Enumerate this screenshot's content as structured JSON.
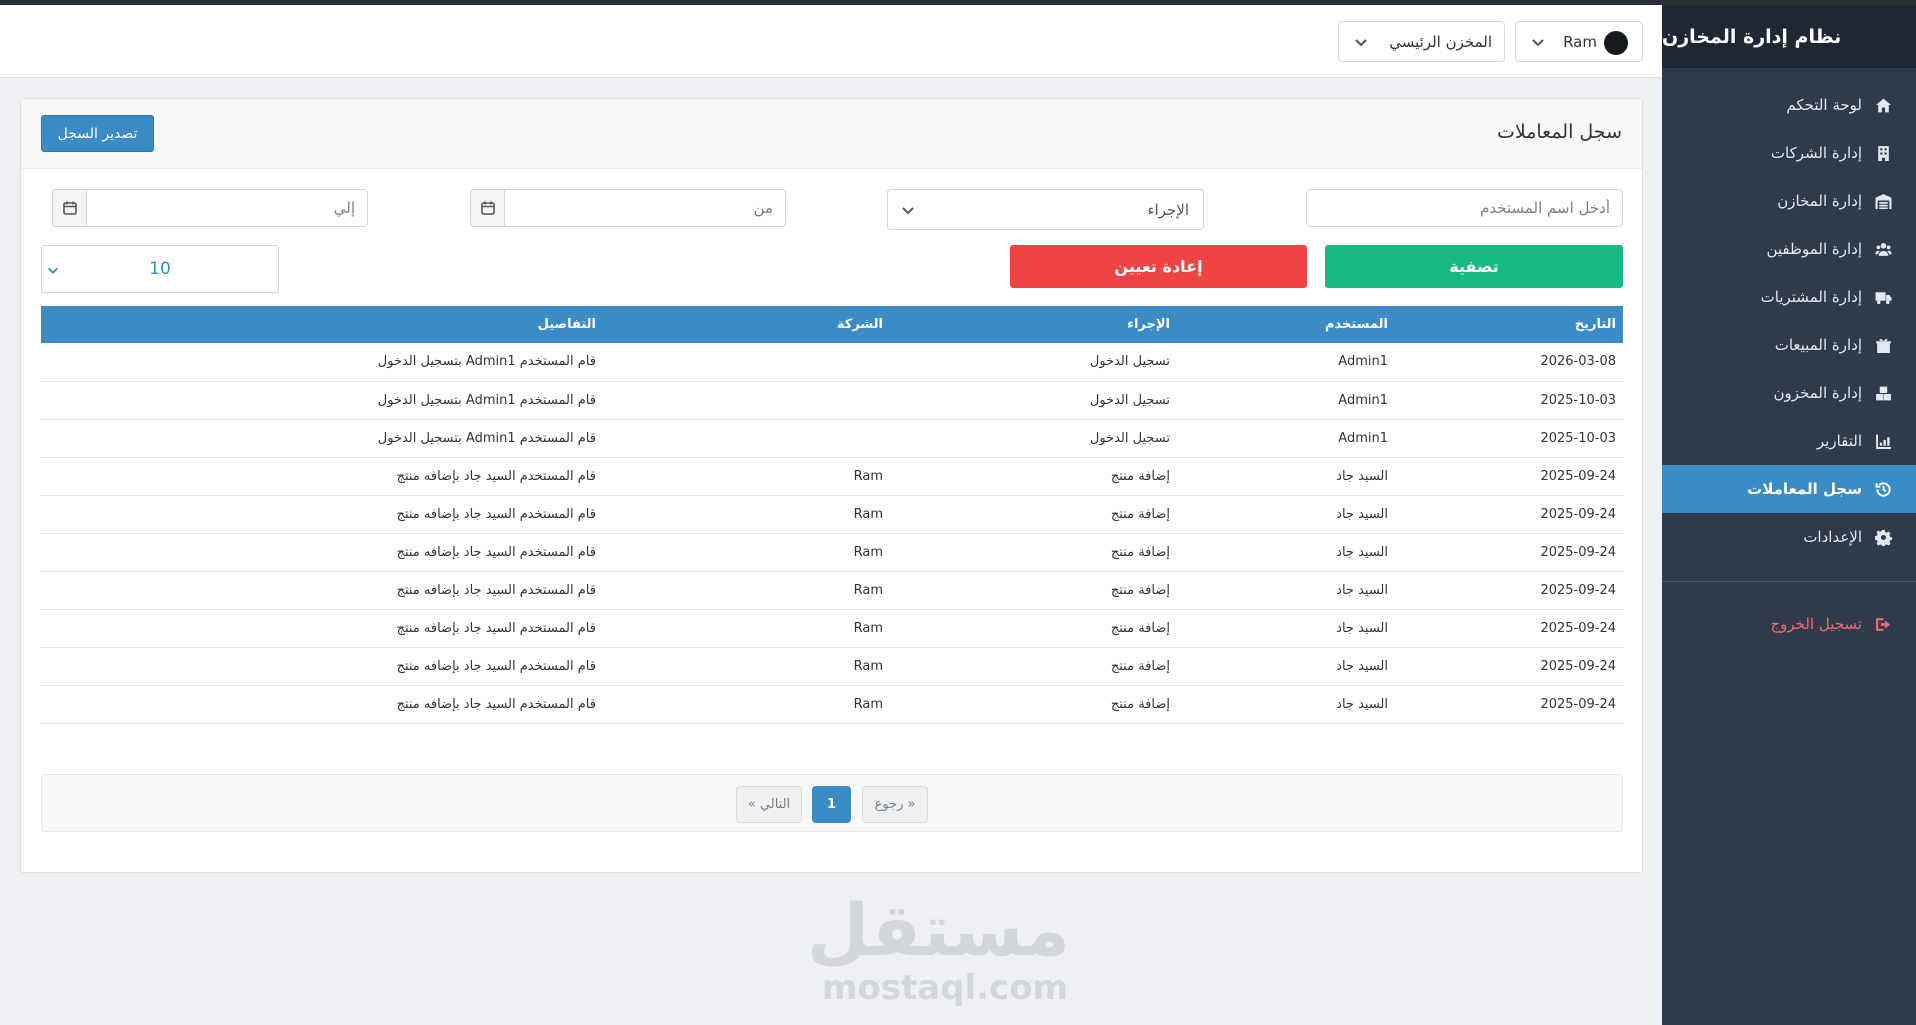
{
  "app": {
    "title": "نظام إدارة المخازن"
  },
  "sidebar": {
    "items": [
      {
        "label": "لوحة التحكم",
        "icon": "home-icon"
      },
      {
        "label": "إدارة الشركات",
        "icon": "building-icon"
      },
      {
        "label": "إدارة المخازن",
        "icon": "warehouse-icon"
      },
      {
        "label": "إدارة الموظفين",
        "icon": "users-icon"
      },
      {
        "label": "إدارة المشتريات",
        "icon": "truck-icon"
      },
      {
        "label": "إدارة المبيعات",
        "icon": "sales-icon"
      },
      {
        "label": "إدارة المخزون",
        "icon": "boxes-icon"
      },
      {
        "label": "التقارير",
        "icon": "chart-icon"
      },
      {
        "label": "سجل المعاملات",
        "icon": "history-icon",
        "active": true
      },
      {
        "label": "الإعدادات",
        "icon": "gear-icon"
      }
    ],
    "logout": "تسجيل الخروج"
  },
  "header": {
    "user_label": "Ram",
    "warehouse_label": "المخزن الرئيسي"
  },
  "page": {
    "title": "سجل المعاملات",
    "export_label": "تصدير السجل"
  },
  "filters": {
    "username_placeholder": "أدخل اسم المستخدم",
    "action_label": "الإجراء",
    "from_placeholder": "من",
    "to_placeholder": "إلي",
    "filter_label": "تصفية",
    "reset_label": "إعادة تعيين",
    "page_size": "10"
  },
  "table": {
    "headers": [
      "التاريخ",
      "المستخدم",
      "الإجراء",
      "الشركة",
      "التفاصيل"
    ],
    "rows": [
      [
        "2026-03-08",
        "Admin1",
        "تسجيل الدخول",
        "",
        "قام المستخدم Admin1 بتسجيل الدخول"
      ],
      [
        "2025-10-03",
        "Admin1",
        "تسجيل الدخول",
        "",
        "قام المستخدم Admin1 بتسجيل الدخول"
      ],
      [
        "2025-10-03",
        "Admin1",
        "تسجيل الدخول",
        "",
        "قام المستخدم Admin1 بتسجيل الدخول"
      ],
      [
        "2025-09-24",
        "السيد جاد",
        "إضافة منتج",
        "Ram",
        "قام المستخدم السيد جاد بإضافه منتج"
      ],
      [
        "2025-09-24",
        "السيد جاد",
        "إضافة منتج",
        "Ram",
        "قام المستخدم السيد جاد بإضافه منتج"
      ],
      [
        "2025-09-24",
        "السيد جاد",
        "إضافة منتج",
        "Ram",
        "قام المستخدم السيد جاد بإضافه منتج"
      ],
      [
        "2025-09-24",
        "السيد جاد",
        "إضافة منتج",
        "Ram",
        "قام المستخدم السيد جاد بإضافه منتج"
      ],
      [
        "2025-09-24",
        "السيد جاد",
        "إضافة منتج",
        "Ram",
        "قام المستخدم السيد جاد بإضافه منتج"
      ],
      [
        "2025-09-24",
        "السيد جاد",
        "إضافة منتج",
        "Ram",
        "قام المستخدم السيد جاد بإضافه منتج"
      ],
      [
        "2025-09-24",
        "السيد جاد",
        "إضافة منتج",
        "Ram",
        "قام المستخدم السيد جاد بإضافه منتج"
      ]
    ]
  },
  "pagination": {
    "prev_label": "« رجوع",
    "current": "1",
    "next_label": "التالي »"
  },
  "watermark": {
    "arabic": "مستقل",
    "latin": "mostaql.com"
  },
  "colors": {
    "accent": "#3b8bc4",
    "success": "#18b981",
    "danger": "#ef4444",
    "sidebar": "#2f3a4a"
  }
}
